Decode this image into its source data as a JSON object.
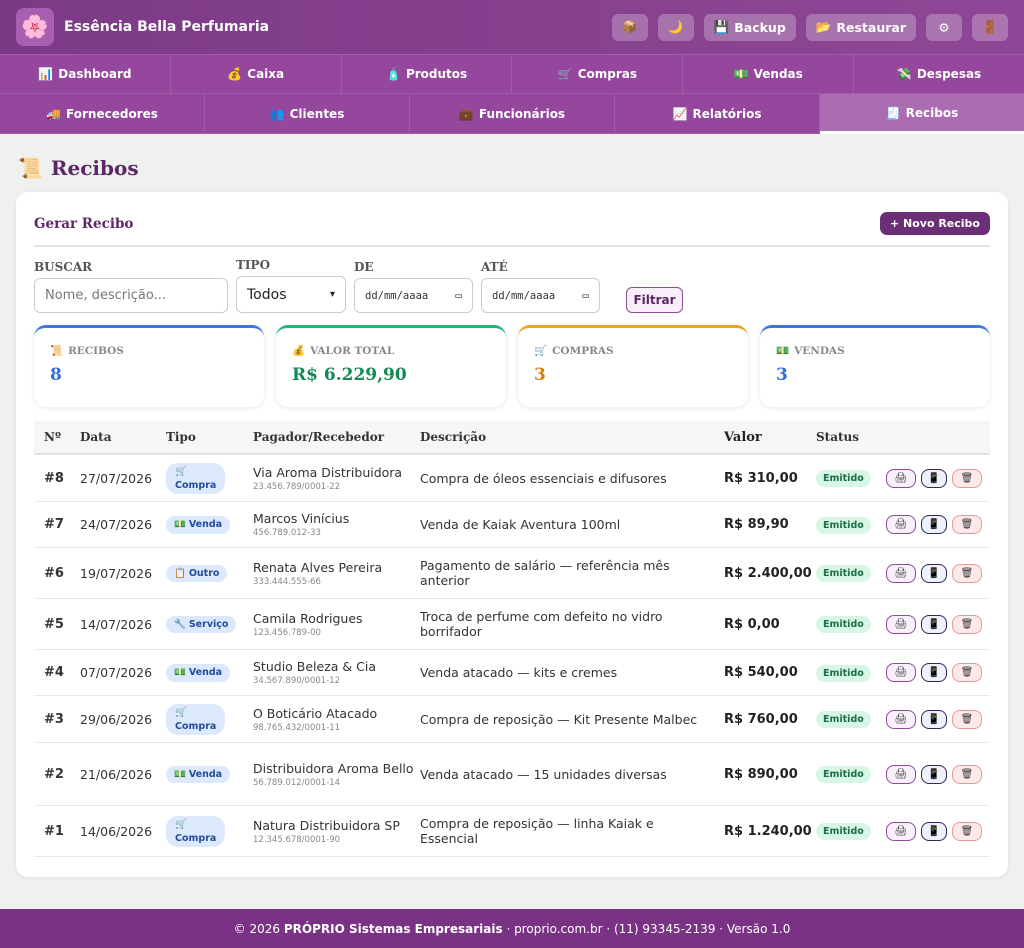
{
  "header": {
    "logo_glyph": "🌸",
    "brand": "Essência Bella Perfumaria",
    "buttons": [
      {
        "icon": "📦",
        "label": "",
        "name": "box-icon"
      },
      {
        "icon": "🌙",
        "label": "",
        "name": "moon-icon"
      },
      {
        "icon": "💾",
        "label": "Backup",
        "name": "floppy-icon"
      },
      {
        "icon": "📂",
        "label": "Restaurar",
        "name": "folder-icon"
      },
      {
        "icon": "⚙",
        "label": "",
        "name": "gear-icon"
      },
      {
        "icon": "🚪",
        "label": "",
        "name": "door-icon"
      }
    ]
  },
  "nav_row1": [
    {
      "icon": "📊",
      "label": "Dashboard"
    },
    {
      "icon": "💰",
      "label": "Caixa"
    },
    {
      "icon": "🧴",
      "label": "Produtos"
    },
    {
      "icon": "🛒",
      "label": "Compras"
    },
    {
      "icon": "💵",
      "label": "Vendas"
    },
    {
      "icon": "💸",
      "label": "Despesas"
    }
  ],
  "nav_row2": [
    {
      "icon": "🚚",
      "label": "Fornecedores"
    },
    {
      "icon": "👥",
      "label": "Clientes"
    },
    {
      "icon": "💼",
      "label": "Funcionários"
    },
    {
      "icon": "📈",
      "label": "Relatórios"
    },
    {
      "icon": "🧾",
      "label": "Recibos",
      "active": true
    }
  ],
  "page": {
    "icon": "📜",
    "title": "Recibos"
  },
  "card": {
    "title": "Gerar Recibo",
    "new_button": "+ Novo Recibo"
  },
  "filters": {
    "search_label": "BUSCAR",
    "search_placeholder": "Nome, descrição...",
    "tipo_label": "TIPO",
    "tipo_value": "Todos",
    "de_label": "DE",
    "ate_label": "ATÉ",
    "date_placeholder": "dd/mm/aaaa",
    "filter_button": "Filtrar"
  },
  "stats": [
    {
      "icon": "📜",
      "label": "RECIBOS",
      "value": "8",
      "color": "#2f6fd6",
      "accent": "#3a7ad9"
    },
    {
      "icon": "💰",
      "label": "VALOR TOTAL",
      "value": "R$ 6.229,90",
      "color": "#138a55",
      "accent": "#1db673"
    },
    {
      "icon": "🛒",
      "label": "COMPRAS",
      "value": "3",
      "color": "#d77f0c",
      "accent": "#f0a21c"
    },
    {
      "icon": "💵",
      "label": "VENDAS",
      "value": "3",
      "color": "#2f6fd6",
      "accent": "#3a7ad9"
    }
  ],
  "table": {
    "headers": [
      "Nº",
      "Data",
      "Tipo",
      "Pagador/Recebedor",
      "Descrição",
      "Valor",
      "Status"
    ],
    "rows": [
      {
        "num": "#8",
        "date": "27/07/2026",
        "tipo_icon": "🛒",
        "tipo": "Compra",
        "name": "Via Aroma Distribuidora",
        "doc": "23.456.789/0001-22",
        "desc": "Compra de óleos essenciais e difusores",
        "valor": "R$ 310,00",
        "status": "Emitido"
      },
      {
        "num": "#7",
        "date": "24/07/2026",
        "tipo_icon": "💵",
        "tipo": "Venda",
        "name": "Marcos Vinícius",
        "doc": "456.789.012-33",
        "desc": "Venda de Kaiak Aventura 100ml",
        "valor": "R$ 89,90",
        "status": "Emitido"
      },
      {
        "num": "#6",
        "date": "19/07/2026",
        "tipo_icon": "📋",
        "tipo": "Outro",
        "name": "Renata Alves Pereira",
        "doc": "333.444.555-66",
        "desc": "Pagamento de salário — referência mês anterior",
        "valor": "R$ 2.400,00",
        "status": "Emitido"
      },
      {
        "num": "#5",
        "date": "14/07/2026",
        "tipo_icon": "🔧",
        "tipo": "Serviço",
        "name": "Camila Rodrigues",
        "doc": "123.456.789-00",
        "desc": "Troca de perfume com defeito no vidro borrifador",
        "valor": "R$ 0,00",
        "status": "Emitido"
      },
      {
        "num": "#4",
        "date": "07/07/2026",
        "tipo_icon": "💵",
        "tipo": "Venda",
        "name": "Studio Beleza & Cia",
        "doc": "34.567.890/0001-12",
        "desc": "Venda atacado — kits e cremes",
        "valor": "R$ 540,00",
        "status": "Emitido"
      },
      {
        "num": "#3",
        "date": "29/06/2026",
        "tipo_icon": "🛒",
        "tipo": "Compra",
        "name": "O Boticário Atacado",
        "doc": "98.765.432/0001-11",
        "desc": "Compra de reposição — Kit Presente Malbec",
        "valor": "R$ 760,00",
        "status": "Emitido"
      },
      {
        "num": "#2",
        "date": "21/06/2026",
        "tipo_icon": "💵",
        "tipo": "Venda",
        "name": "Distribuidora Aroma Bello",
        "doc": "56.789.012/0001-14",
        "desc": "Venda atacado — 15 unidades diversas",
        "valor": "R$ 890,00",
        "status": "Emitido"
      },
      {
        "num": "#1",
        "date": "14/06/2026",
        "tipo_icon": "🛒",
        "tipo": "Compra",
        "name": "Natura Distribuidora SP",
        "doc": "12.345.678/0001-90",
        "desc": "Compra de reposição — linha Kaiak e Essencial",
        "valor": "R$ 1.240,00",
        "status": "Emitido"
      }
    ],
    "action_icons": {
      "print": "🖨",
      "whatsapp": "📱",
      "delete": "🗑"
    }
  },
  "footer": {
    "prefix": "© 2026 ",
    "company": "PRÓPRIO Sistemas Empresariais",
    "rest": " · proprio.com.br · (11) 93345-2139 · Versão 1.0"
  }
}
